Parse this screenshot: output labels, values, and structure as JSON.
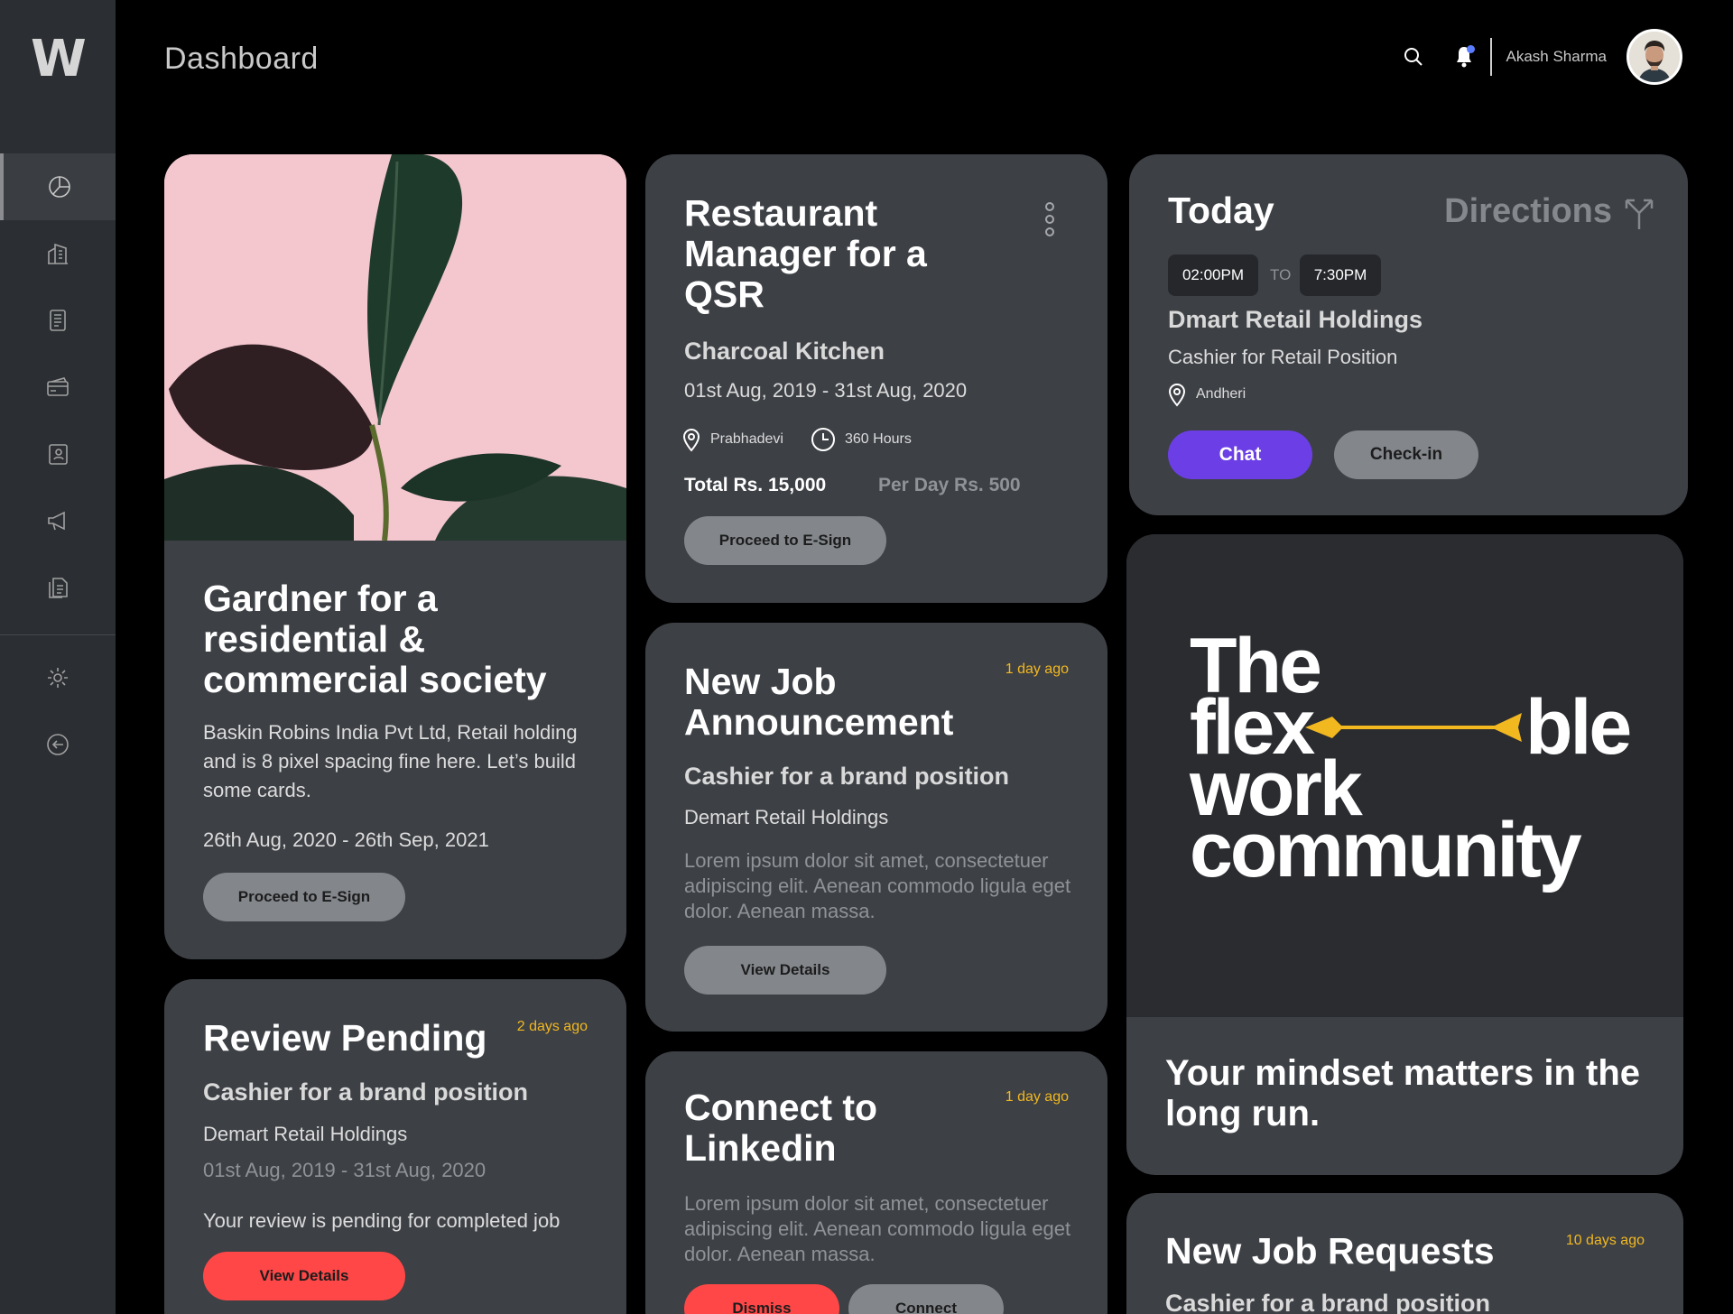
{
  "app": {
    "logo": "W",
    "title": "Dashboard"
  },
  "header": {
    "user_name": "Akash Sharma"
  },
  "cards": {
    "gardener": {
      "title": "Gardner for a residential & commercial society",
      "description": "Baskin Robins India Pvt Ltd, Retail holding and is 8 pixel spacing fine here. Let’s build some cards.",
      "dates": "26th Aug, 2020 - 26th Sep, 2021",
      "button": "Proceed to E-Sign"
    },
    "review": {
      "title": "Review Pending",
      "ago": "2 days ago",
      "position": "Cashier for a brand position",
      "company": "Demart Retail Holdings",
      "dates": "01st Aug, 2019 - 31st Aug, 2020",
      "note": "Your review is pending for completed job",
      "button": "View Details"
    },
    "restaurant": {
      "title": "Restaurant Manager for a QSR",
      "company": "Charcoal Kitchen",
      "dates": "01st Aug, 2019 - 31st Aug, 2020",
      "location": "Prabhadevi",
      "hours": "360 Hours",
      "total": "Total Rs. 15,000",
      "per_day": "Per Day Rs. 500",
      "button": "Proceed to E-Sign"
    },
    "announcement": {
      "title": "New Job Announcement",
      "ago": "1 day ago",
      "position": "Cashier for a brand position",
      "company": "Demart Retail Holdings",
      "body": "Lorem ipsum dolor sit amet, consectetuer adipiscing elit. Aenean commodo ligula eget dolor. Aenean massa.",
      "button": "View Details"
    },
    "linkedin": {
      "title": "Connect to Linkedin",
      "ago": "1 day ago",
      "body": "Lorem ipsum dolor sit amet, consectetuer adipiscing elit. Aenean commodo ligula eget dolor. Aenean massa.",
      "dismiss": "Dismiss",
      "connect": "Connect"
    },
    "today": {
      "title": "Today",
      "directions": "Directions",
      "time_from": "02:00PM",
      "to": "TO",
      "time_to": "7:30PM",
      "company": "Dmart Retail Holdings",
      "position": "Cashier for Retail Position",
      "location": "Andheri",
      "chat": "Chat",
      "checkin": "Check-in"
    },
    "promo": {
      "line1": "The",
      "line2a": "flex",
      "line2b": "ble",
      "line3": "work",
      "line4": "community",
      "tagline": "Your mindset matters in the long run."
    },
    "requests": {
      "title": "New Job Requests",
      "ago": "10 days ago",
      "position": "Cashier for a brand position"
    }
  },
  "colors": {
    "accent_purple": "#6c3fe6",
    "accent_red": "#ff4747",
    "accent_yellow": "#f2b820",
    "card_bg": "#3d4045"
  },
  "icons": [
    "search-icon",
    "bell-icon",
    "pie-chart-icon",
    "building-icon",
    "document-icon",
    "card-icon",
    "id-card-icon",
    "megaphone-icon",
    "files-icon",
    "gear-icon",
    "logout-icon",
    "location-icon",
    "clock-icon",
    "more-vertical-icon",
    "directions-icon"
  ]
}
